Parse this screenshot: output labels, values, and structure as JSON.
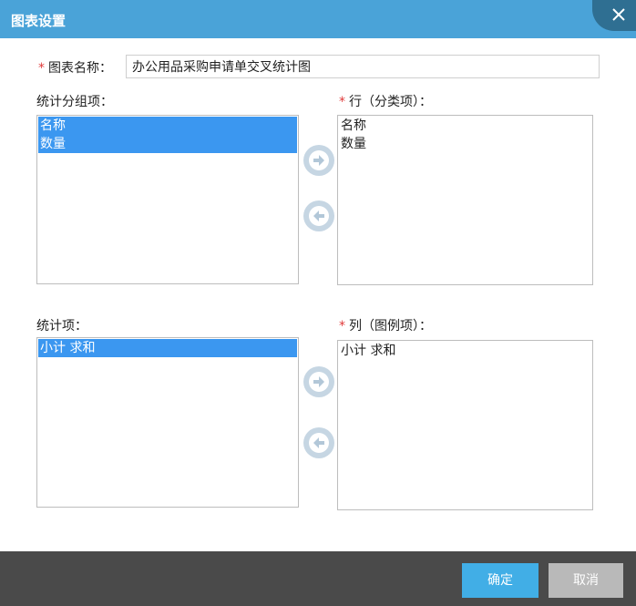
{
  "dialog": {
    "title": "图表设置",
    "close_icon": "close-icon"
  },
  "chart_name": {
    "required_mark": "*",
    "label": "图表名称：",
    "value": "办公用品采购申请单交叉统计图"
  },
  "group_items": {
    "label": "统计分组项：",
    "items": [
      {
        "label": "名称",
        "selected": true
      },
      {
        "label": "数量",
        "selected": true
      }
    ]
  },
  "row_items": {
    "required_mark": "*",
    "label": "行（分类项）：",
    "items": [
      {
        "label": "名称",
        "selected": false
      },
      {
        "label": "数量",
        "selected": false
      }
    ]
  },
  "stat_items": {
    "label": "统计项：",
    "items": [
      {
        "label": "小计 求和",
        "selected": true
      }
    ]
  },
  "col_items": {
    "required_mark": "*",
    "label": "列（图例项）：",
    "items": [
      {
        "label": "小计 求和",
        "selected": false
      }
    ]
  },
  "buttons": {
    "ok": "确定",
    "cancel": "取消"
  },
  "colors": {
    "titlebar": "#4aa3d8",
    "selection": "#3b97f0",
    "ok_button": "#41aee6",
    "cancel_button": "#b9b9b9",
    "footer": "#4a4a4a",
    "required": "#e03a3a"
  }
}
